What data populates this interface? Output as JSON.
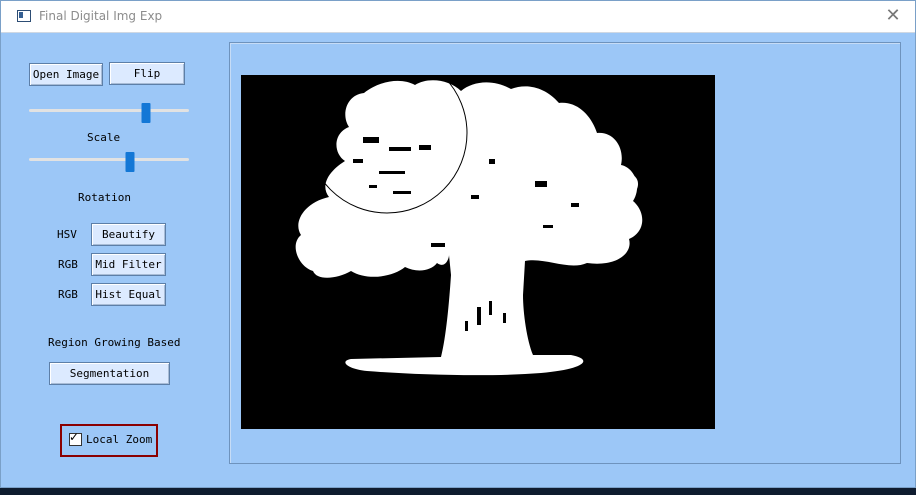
{
  "window": {
    "title": "Final Digital Img Exp",
    "close_glyph": "✕"
  },
  "toolbar": {
    "open_image": "Open Image",
    "flip": "Flip"
  },
  "sliders": {
    "scale_label": "Scale",
    "scale_value": 0.73,
    "rotation_label": "Rotation",
    "rotation_value": 0.63
  },
  "rows": [
    {
      "mode": "HSV",
      "button": "Beautify"
    },
    {
      "mode": "RGB",
      "button": "Mid Filter"
    },
    {
      "mode": "RGB",
      "button": "Hist Equal"
    }
  ],
  "segmentation": {
    "heading": "Region Growing Based",
    "button": "Segmentation"
  },
  "local_zoom": {
    "label": "Local Zoom",
    "checked": true,
    "check_glyph": "✓"
  },
  "colors": {
    "window_bg": "#9cc7f7",
    "accent": "#1377d6",
    "highlight": "#8b0000",
    "canvas_bg": "#000000",
    "foreground": "#ffffff"
  },
  "icons": [
    "app-window-icon",
    "close-icon",
    "checkmark-icon"
  ]
}
